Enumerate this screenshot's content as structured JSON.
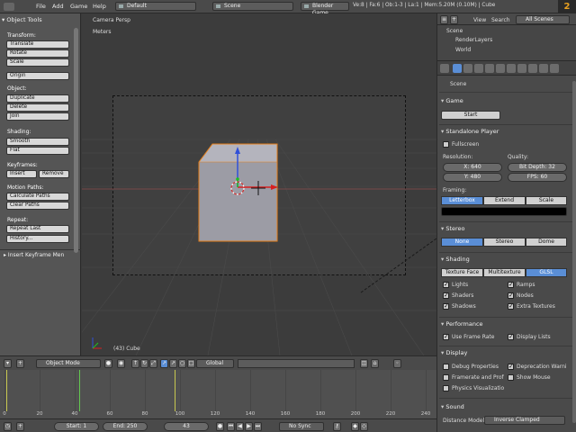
{
  "topbar": {
    "menus": [
      "File",
      "Add",
      "Game",
      "Help"
    ],
    "layout": "Default",
    "scene": "Scene",
    "engine": "Blender Game",
    "stats": "Ve:8 | Fa:6 | Ob:1-3 | La:1 | Mem:5.20M (0.10M) | Cube",
    "logo": "2"
  },
  "tools": {
    "header": "▾ Object Tools",
    "transform_label": "Transform:",
    "translate": "Translate",
    "rotate": "Rotate",
    "scale": "Scale",
    "origin": "Origin",
    "object_label": "Object:",
    "duplicate": "Duplicate",
    "delete": "Delete",
    "join": "Join",
    "shading_label": "Shading:",
    "smooth": "Smooth",
    "flat": "Flat",
    "keyframes_label": "Keyframes:",
    "insert": "Insert",
    "remove": "Remove",
    "motion_label": "Motion Paths:",
    "calc_paths": "Calculate Paths",
    "clear_paths": "Clear Paths",
    "repeat_label": "Repeat:",
    "repeat_last": "Repeat Last",
    "history": "History...",
    "insert_keyframe": "▸ Insert Keyframe Men"
  },
  "viewport": {
    "view_name": "Camera Persp",
    "units": "Meters",
    "object_info": "(43) Cube"
  },
  "viewport_header": {
    "mode": "Object Mode",
    "orientation": "Global"
  },
  "timeline": {
    "ticks": [
      "0",
      "20",
      "40",
      "60",
      "80",
      "100",
      "120",
      "140",
      "160",
      "180",
      "200",
      "220",
      "240"
    ],
    "start": "Start: 1",
    "end": "End: 250",
    "current": "43",
    "sync": "No Sync"
  },
  "outliner": {
    "view": "View",
    "search": "Search",
    "filter": "All Scenes",
    "items": [
      "Scene",
      "RenderLayers",
      "World"
    ]
  },
  "properties": {
    "context": "Scene",
    "game_header": "Game",
    "start": "Start",
    "player_header": "Standalone Player",
    "fullscreen": "Fullscreen",
    "resolution_label": "Resolution:",
    "res_x": "X: 640",
    "res_y": "Y: 480",
    "quality_label": "Quality:",
    "bit_depth": "Bit Depth: 32",
    "fps": "FPS: 60",
    "framing_label": "Framing:",
    "framing": [
      "Letterbox",
      "Extend",
      "Scale"
    ],
    "stereo_header": "Stereo",
    "stereo": [
      "None",
      "Stereo",
      "Dome"
    ],
    "shading_header": "Shading",
    "shading_modes": [
      "Texture Face",
      "Multitexture",
      "GLSL"
    ],
    "shading_checks": [
      "Lights",
      "Ramps",
      "Shaders",
      "Nodes",
      "Shadows",
      "Extra Textures"
    ],
    "perf_header": "Performance",
    "frame_rate": "Use Frame Rate",
    "display_lists": "Display Lists",
    "display_header": "Display",
    "debug_props": "Debug Properties",
    "deprecation": "Deprecation Warni",
    "framerate_prof": "Framerate and Prof",
    "show_mouse": "Show Mouse",
    "physics_vis": "Physics Visualizatio",
    "sound_header": "Sound",
    "distance_label": "Distance Model:",
    "distance_model": "Inverse Clamped"
  },
  "colors": {
    "selection_outline": "#e8801a",
    "active_tab": "#5a8ed6",
    "keyframe": "#c8c850",
    "current_frame": "#64c850"
  }
}
